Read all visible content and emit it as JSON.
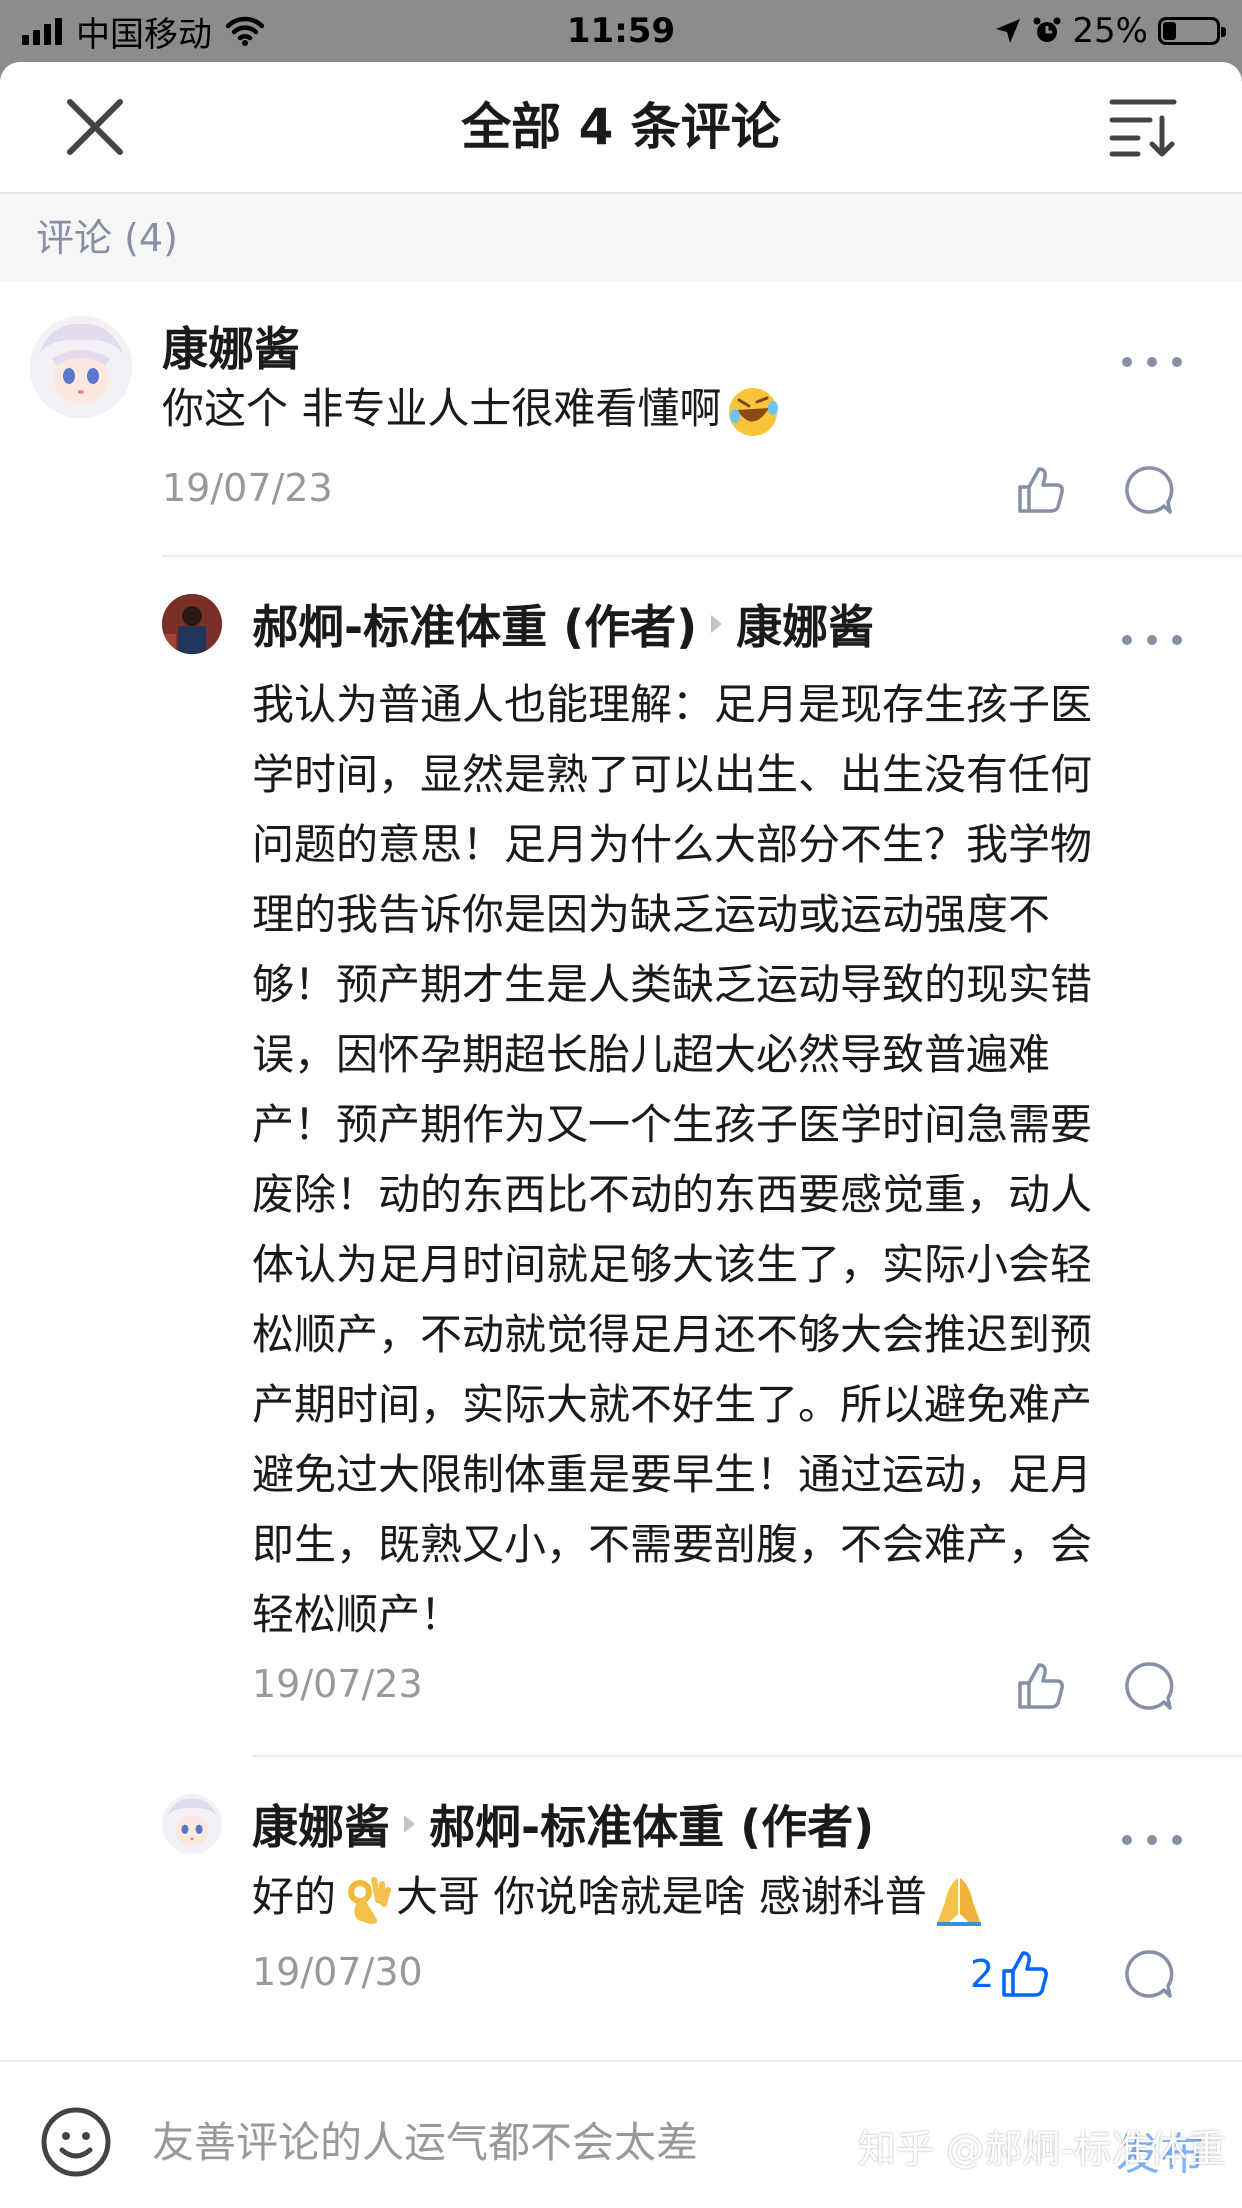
{
  "status_bar": {
    "carrier": "中国移动",
    "time": "11:59",
    "battery": "25%",
    "battery_level": 0.25,
    "icons": [
      "signal-icon",
      "wifi-icon",
      "location-icon",
      "alarm-icon",
      "battery-icon"
    ]
  },
  "header": {
    "title": "全部 4 条评论",
    "close_icon": "close-icon",
    "sort_icon": "sort-icon"
  },
  "section": {
    "label": "评论 (4)"
  },
  "comments": [
    {
      "author": "康娜酱",
      "text": "你这个 非专业人士很难看懂啊",
      "emoji": "rofl-emoji",
      "date": "19/07/23",
      "likes": ""
    },
    {
      "author": "郝炯-标准体重 (作者)",
      "reply_to": "康娜酱",
      "lines": [
        "我认为普通人也能理解：足月是现存生孩子医",
        "学时间，显然是熟了可以出生、出生没有任何",
        "问题的意思！足月为什么大部分不生？我学物",
        "理的我告诉你是因为缺乏运动或运动强度不",
        "够！预产期才生是人类缺乏运动导致的现实错",
        "误，因怀孕期超长胎儿超大必然导致普遍难",
        "产！预产期作为又一个生孩子医学时间急需要",
        "废除！动的东西比不动的东西要感觉重，动人",
        "体认为足月时间就足够大该生了，实际小会轻",
        "松顺产，不动就觉得足月还不够大会推迟到预",
        "产期时间，实际大就不好生了。所以避免难产",
        "避免过大限制体重是要早生！通过运动，足月",
        "即生，既熟又小，不需要剖腹，不会难产，会",
        "轻松顺产！"
      ],
      "date": "19/07/23",
      "likes": ""
    },
    {
      "author": "康娜酱",
      "reply_to": "郝炯-标准体重 (作者)",
      "text_a": "好的",
      "emoji_a": "ok-hand-emoji",
      "text_b": "大哥 你说啥就是啥 感谢科普",
      "emoji_b": "folded-hands-emoji",
      "date": "19/07/30",
      "likes": "2"
    }
  ],
  "bottom_bar": {
    "emoji_icon": "smiley-icon",
    "placeholder": "友善评论的人运气都不会太差",
    "publish_label": "发布",
    "watermark": "知乎 @郝炯-标准体重"
  },
  "colors": {
    "accent": "#0066ff",
    "meta_gray": "#999999",
    "muted_blue_gray": "#8590a6",
    "section_bg": "#f6f6f6"
  }
}
